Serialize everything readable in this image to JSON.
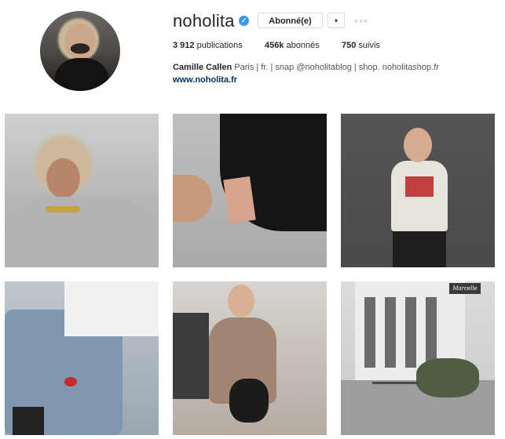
{
  "profile": {
    "username": "noholita",
    "verified_mark": "✓",
    "follow_button_label": "Abonné(e)",
    "dropdown_caret": "▾",
    "more_options": "◦◦◦",
    "stats": {
      "posts_value": "3 912",
      "posts_label": "publications",
      "followers_value": "456k",
      "followers_label": "abonnés",
      "following_value": "750",
      "following_label": "suivis"
    },
    "bio": {
      "full_name": "Camille Callen",
      "text": "Paris | fr. | snap @noholitablog | shop. noholitashop.fr"
    },
    "website": "www.noholita.fr"
  },
  "posts": {
    "p6_sign": "Marcelle"
  },
  "colors": {
    "verified_badge": "#3897f0",
    "link": "#003569",
    "border": "#dbdbdb"
  }
}
